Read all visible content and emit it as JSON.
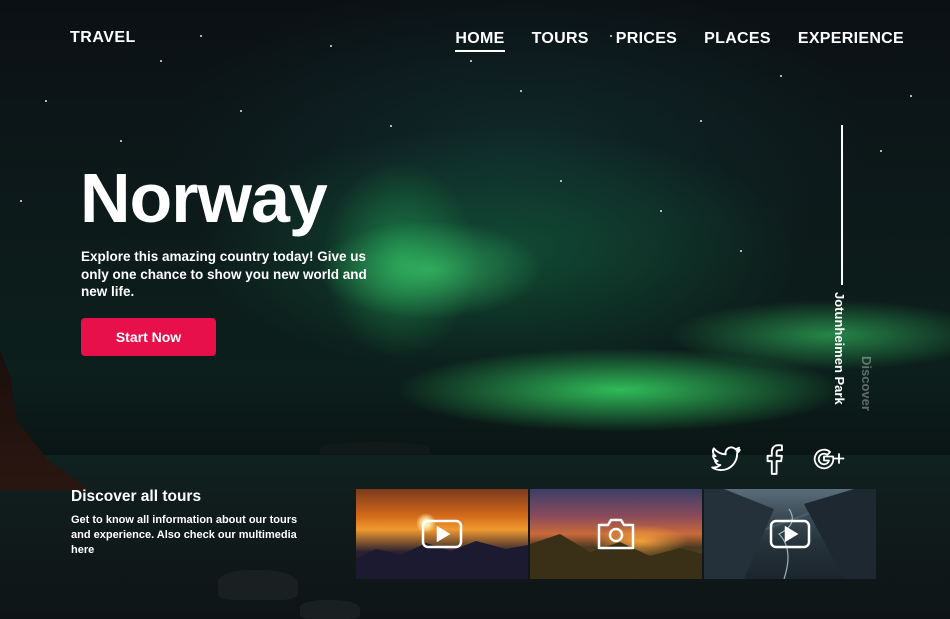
{
  "brand": "TRAVEL",
  "nav": [
    {
      "label": "HOME",
      "active": true
    },
    {
      "label": "TOURS",
      "active": false
    },
    {
      "label": "PRICES",
      "active": false
    },
    {
      "label": "PLACES",
      "active": false
    },
    {
      "label": "EXPERIENCE",
      "active": false
    }
  ],
  "hero": {
    "title": "Norway",
    "tagline": "Explore this amazing country today! Give us only one chance to show you new world and new life.",
    "cta_label": "Start Now"
  },
  "side": {
    "place": "Jotunheimen Park",
    "discover": "Discover"
  },
  "social": [
    "twitter-icon",
    "facebook-icon",
    "google-plus-icon"
  ],
  "tours": {
    "title": "Discover all tours",
    "description": "Get to know all information about our tours and experience. Also check our multimedia here"
  },
  "media": [
    {
      "type": "video",
      "icon": "play-icon"
    },
    {
      "type": "photo",
      "icon": "camera-icon"
    },
    {
      "type": "video",
      "icon": "play-icon"
    }
  ],
  "colors": {
    "accent": "#e8104a",
    "aurora": "#3ee870",
    "text": "#ffffff"
  }
}
